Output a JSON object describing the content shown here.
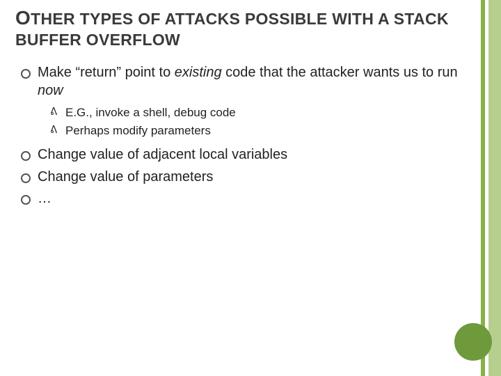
{
  "title": {
    "first_letter": "O",
    "rest_line1": "THER TYPES OF ATTACKS POSSIBLE WITH A STACK",
    "line2": "BUFFER OVERFLOW"
  },
  "bullets": {
    "item1": {
      "pre": "Make “return” point to ",
      "em1": "existing",
      "mid": " code that the attacker wants us to run ",
      "em2": "now",
      "sub": {
        "a": "E.G., invoke a shell, debug code",
        "b": "Perhaps modify parameters"
      }
    },
    "item2": "Change value of adjacent local variables",
    "item3": "Change value of parameters",
    "item4": "…"
  }
}
